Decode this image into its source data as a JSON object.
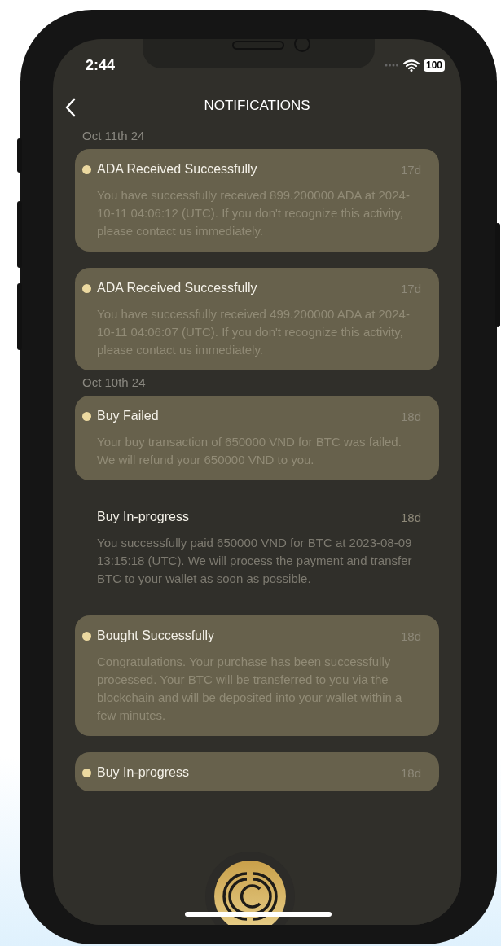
{
  "status_bar": {
    "time": "2:44",
    "battery": "100"
  },
  "header": {
    "title": "NOTIFICATIONS"
  },
  "groups": [
    {
      "date": "Oct 11th 24",
      "items": [
        {
          "title": "ADA Received Successfully",
          "age": "17d",
          "unread": true,
          "body": "You have successfully received 899.200000 ADA at 2024-10-11 04:06:12 (UTC). If you don't recognize this activity, please contact us immediately."
        },
        {
          "title": "ADA Received Successfully",
          "age": "17d",
          "unread": true,
          "body": "You have successfully received 499.200000 ADA at 2024-10-11 04:06:07 (UTC). If you don't recognize this activity, please contact us immediately."
        }
      ]
    },
    {
      "date": "Oct 10th 24",
      "items": [
        {
          "title": "Buy Failed",
          "age": "18d",
          "unread": true,
          "body": "Your buy transaction of 650000 VND for BTC was failed. We will refund your 650000 VND to you."
        },
        {
          "title": "Buy In-progress",
          "age": "18d",
          "unread": false,
          "body": "You successfully paid 650000 VND for BTC at 2023-08-09 13:15:18 (UTC). We will process the payment and transfer BTC to your wallet as soon as possible."
        },
        {
          "title": "Bought Successfully",
          "age": "18d",
          "unread": true,
          "body": "Congratulations. Your purchase has been successfully processed. Your BTC will be transferred to you via the blockchain and will be deposited into your wallet within a few minutes."
        },
        {
          "title": "Buy In-progress",
          "age": "18d",
          "unread": true
        }
      ]
    }
  ]
}
